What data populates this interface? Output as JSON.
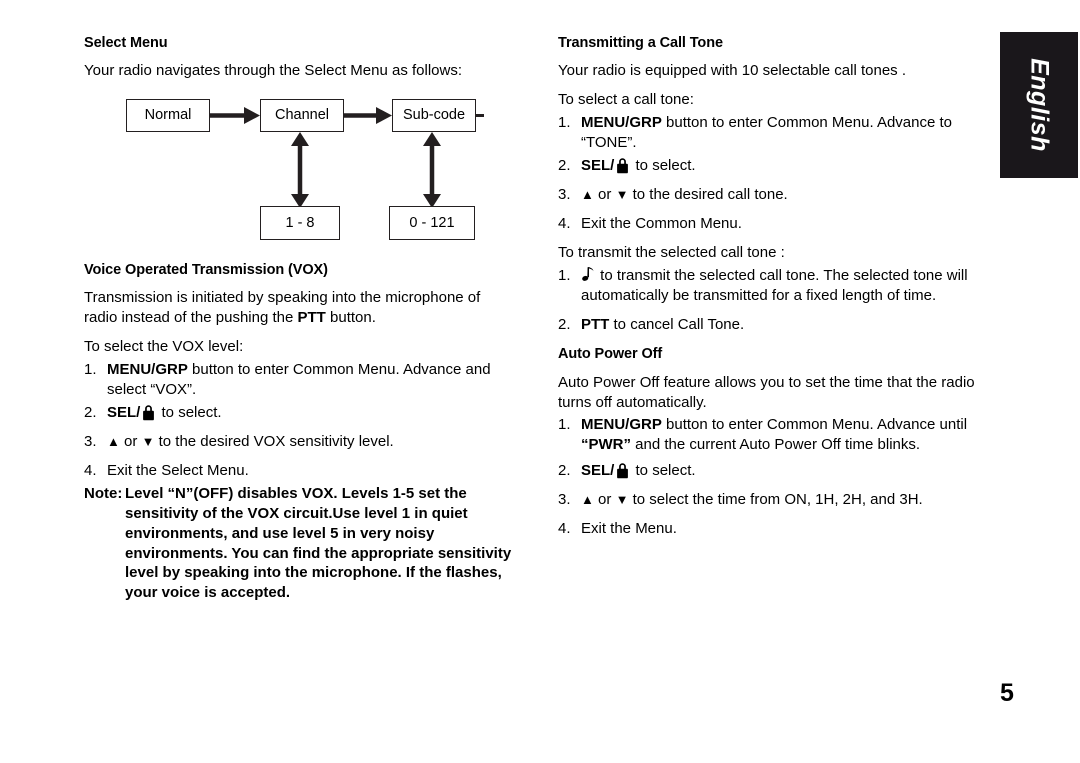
{
  "page": {
    "language_tab": "English",
    "page_number": "5"
  },
  "left_column": {
    "select_menu": {
      "heading": "Select Menu",
      "intro": "Your radio navigates through the Select Menu as follows:",
      "diagram": {
        "type": "flow",
        "nodes": [
          {
            "id": "normal",
            "label": "Normal"
          },
          {
            "id": "channel",
            "label": "Channel"
          },
          {
            "id": "subcode",
            "label": "Sub-code"
          },
          {
            "id": "range1",
            "label": "1 - 8"
          },
          {
            "id": "range2",
            "label": "0 - 121"
          }
        ],
        "edges": [
          {
            "from": "normal",
            "to": "channel",
            "direction": "right"
          },
          {
            "from": "channel",
            "to": "subcode",
            "direction": "right"
          },
          {
            "from": "channel",
            "to": "range1",
            "direction": "both-vertical"
          },
          {
            "from": "subcode",
            "to": "range2",
            "direction": "both-vertical"
          }
        ]
      }
    },
    "vox": {
      "heading": "Voice Operated Transmission (VOX)",
      "para1_a": "Transmission is initiated by speaking into the microphone of radio instead of the pushing the ",
      "para1_bold": "PTT",
      "para1_b": " button.",
      "para2": "To select the VOX level:",
      "steps": [
        {
          "num": "1.",
          "bold": "MENU/GRP",
          "text": " button to enter Common Menu. Advance and select “VOX”."
        },
        {
          "num": "2.",
          "bold": "SEL/",
          "text": " to select.",
          "icon": "lock-icon"
        },
        {
          "num": "3.",
          "text_before": " or ",
          "text_after": " to the desired VOX sensitivity level.",
          "icon_up": "triangle-up-icon",
          "icon_down": "triangle-down-icon"
        },
        {
          "num": "4.",
          "text": "Exit the Select Menu."
        }
      ],
      "note": {
        "label": "Note:",
        "body": "Level “N”(OFF) disables VOX. Levels 1-5 set the sensitivity of the VOX circuit.Use level 1 in quiet environments, and use level 5 in very noisy environments. You can find the appropriate sensitivity level by speaking into the microphone. If the flashes, your voice is accepted."
      }
    }
  },
  "right_column": {
    "call_tone": {
      "heading": "Transmitting a Call Tone",
      "para1": "Your radio is equipped with 10 selectable call tones .",
      "para2": "To select a call tone:",
      "steps": [
        {
          "num": "1.",
          "bold": "MENU/GRP",
          "text": " button to enter Common Menu. Advance to “TONE”."
        },
        {
          "num": "2.",
          "bold": "SEL/",
          "text": " to select.",
          "icon": "lock-icon"
        },
        {
          "num": "3.",
          "text_before": " or ",
          "text_after": " to the desired call tone.",
          "icon_up": "triangle-up-icon",
          "icon_down": "triangle-down-icon"
        },
        {
          "num": "4.",
          "text": "Exit the Common Menu."
        }
      ],
      "para3": "To transmit the selected call tone :",
      "steps2": [
        {
          "num": "1.",
          "text": " to transmit the selected call tone. The selected tone will automatically be transmitted for a fixed length of time.",
          "icon": "music-note-icon"
        },
        {
          "num": "2.",
          "bold": "PTT",
          "text": " to cancel Call Tone."
        }
      ]
    },
    "auto_power_off": {
      "heading": "Auto Power Off",
      "para1": "Auto Power Off feature allows you to set the time that the radio turns off automatically.",
      "steps": [
        {
          "num": "1.",
          "bold": "MENU/GRP",
          "text_a": " button to enter Common Menu. Advance until ",
          "bold2": "“PWR”",
          "text_b": " and the current Auto Power Off time blinks."
        },
        {
          "num": "2.",
          "bold": "SEL/",
          "text": " to select.",
          "icon": "lock-icon"
        },
        {
          "num": "3.",
          "text_before": " or ",
          "text_after": " to select the time from ON, 1H, 2H, and 3H.",
          "icon_up": "triangle-up-icon",
          "icon_down": "triangle-down-icon"
        },
        {
          "num": "4.",
          "text": "Exit the Menu."
        }
      ]
    }
  }
}
